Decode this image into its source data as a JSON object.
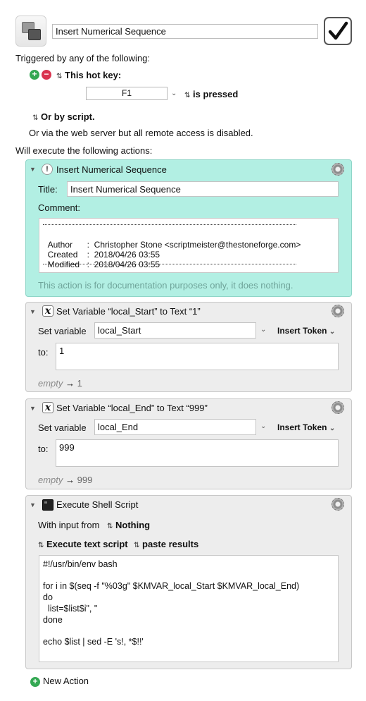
{
  "macro": {
    "name": "Insert Numerical Sequence",
    "icon": "macro-group-icon",
    "enabled_icon": "checkmark-icon"
  },
  "triggers": {
    "heading": "Triggered by any of the following:",
    "hotkey_label": "This hot key:",
    "hotkey_value": "F1",
    "hotkey_condition": "is pressed",
    "script_label": "Or by script.",
    "web_server_note": "Or via the web server but all remote access is disabled."
  },
  "actions_heading": "Will execute the following actions:",
  "actions": {
    "comment": {
      "title": "Insert Numerical Sequence",
      "title_label": "Title:",
      "title_value": "Insert Numerical Sequence",
      "comment_label": "Comment:",
      "lines": [
        {
          "key": "Author",
          "sep": ":",
          "value": "Christopher Stone <scriptmeister@thestoneforge.com>"
        },
        {
          "key": "Created",
          "sep": ":",
          "value": "2018/04/26 03:55"
        },
        {
          "key": "Modified",
          "sep": ":",
          "value": "2018/04/26 03:55"
        }
      ],
      "footer": "This action is for documentation purposes only, it does nothing."
    },
    "setvar1": {
      "title": "Set Variable “local_Start” to Text “1”",
      "set_label": "Set variable",
      "variable": "local_Start",
      "insert_token": "Insert Token",
      "to_label": "to:",
      "value": "1",
      "preview_from": "empty",
      "preview_arrow": "→",
      "preview_to": "1"
    },
    "setvar2": {
      "title": "Set Variable “local_End” to Text “999”",
      "set_label": "Set variable",
      "variable": "local_End",
      "insert_token": "Insert Token",
      "to_label": "to:",
      "value": "999",
      "preview_from": "empty",
      "preview_arrow": "→",
      "preview_to": "999"
    },
    "shell": {
      "title": "Execute Shell Script",
      "input_label": "With input from",
      "input_value": "Nothing",
      "mode": "Execute text script",
      "output": "paste results",
      "script": [
        "#!/usr/bin/env bash",
        "",
        "for i in $(seq -f \"%03g\" $KMVAR_local_Start $KMVAR_local_End)",
        "do",
        "  list=$list$i\", \"",
        "done",
        "",
        "echo $list | sed -E 's!, *$!!'"
      ]
    }
  },
  "new_action": "New Action"
}
